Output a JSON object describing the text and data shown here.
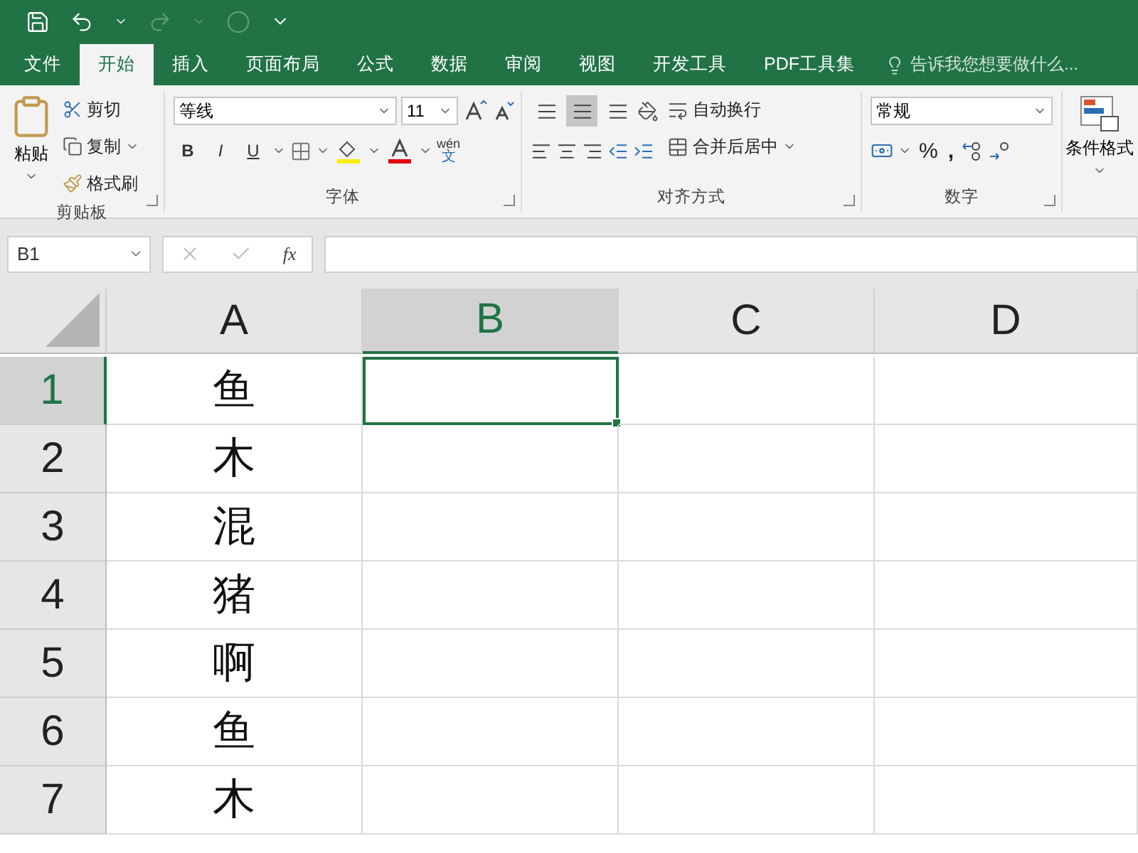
{
  "tabs": [
    {
      "label": "文件",
      "selected": false
    },
    {
      "label": "开始",
      "selected": true
    },
    {
      "label": "插入",
      "selected": false
    },
    {
      "label": "页面布局",
      "selected": false
    },
    {
      "label": "公式",
      "selected": false
    },
    {
      "label": "数据",
      "selected": false
    },
    {
      "label": "审阅",
      "selected": false
    },
    {
      "label": "视图",
      "selected": false
    },
    {
      "label": "开发工具",
      "selected": false
    },
    {
      "label": "PDF工具集",
      "selected": false
    }
  ],
  "tell_me": "告诉我您想要做什么...",
  "clipboard": {
    "paste": "粘贴",
    "cut": "剪切",
    "copy": "复制",
    "format_painter": "格式刷",
    "label": "剪贴板"
  },
  "font": {
    "name": "等线",
    "size": "11",
    "bold": "B",
    "italic": "I",
    "underline": "U",
    "phonetic_top": "wén",
    "phonetic_bottom": "文",
    "label": "字体"
  },
  "alignment": {
    "wrap_text": "自动换行",
    "merge_center": "合并后居中",
    "label": "对齐方式"
  },
  "number": {
    "format": "常规",
    "percent": "%",
    "comma": ",",
    "label": "数字"
  },
  "styles": {
    "conditional_formatting": "条件格式"
  },
  "formula_bar": {
    "name_box": "B1",
    "function_label": "fx"
  },
  "sheet": {
    "columns": [
      {
        "label": "A",
        "selected": false
      },
      {
        "label": "B",
        "selected": true
      },
      {
        "label": "C",
        "selected": false
      },
      {
        "label": "D",
        "selected": false
      }
    ],
    "rows": [
      {
        "number": "1",
        "selected": true,
        "cells": [
          {
            "value": "鱼",
            "selected": false
          },
          {
            "selected": true
          },
          {
            "selected": false
          },
          {
            "selected": false
          }
        ]
      },
      {
        "number": "2",
        "selected": false,
        "cells": [
          {
            "value": "木",
            "selected": false
          },
          {
            "selected": false
          },
          {
            "selected": false
          },
          {
            "selected": false
          }
        ]
      },
      {
        "number": "3",
        "selected": false,
        "cells": [
          {
            "value": "混",
            "selected": false
          },
          {
            "selected": false
          },
          {
            "selected": false
          },
          {
            "selected": false
          }
        ]
      },
      {
        "number": "4",
        "selected": false,
        "cells": [
          {
            "value": "猪",
            "selected": false
          },
          {
            "selected": false
          },
          {
            "selected": false
          },
          {
            "selected": false
          }
        ]
      },
      {
        "number": "5",
        "selected": false,
        "cells": [
          {
            "value": "啊",
            "selected": false
          },
          {
            "selected": false
          },
          {
            "selected": false
          },
          {
            "selected": false
          }
        ]
      },
      {
        "number": "6",
        "selected": false,
        "cells": [
          {
            "value": "鱼",
            "selected": false
          },
          {
            "selected": false
          },
          {
            "selected": false
          },
          {
            "selected": false
          }
        ]
      },
      {
        "number": "7",
        "selected": false,
        "cells": [
          {
            "value": "木",
            "selected": false
          },
          {
            "selected": false
          },
          {
            "selected": false
          },
          {
            "selected": false
          }
        ]
      }
    ]
  }
}
